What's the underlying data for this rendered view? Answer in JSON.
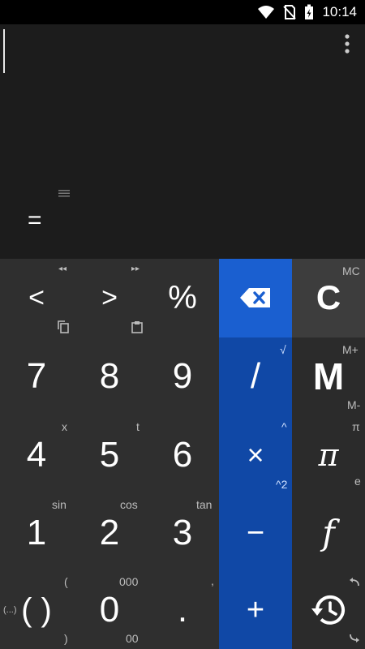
{
  "status": {
    "time": "10:14"
  },
  "display": {
    "equals": "="
  },
  "keys": {
    "row1": {
      "left": {
        "label": "<",
        "sub": "◂◂"
      },
      "right": {
        "label": ">",
        "sub": "▸▸"
      },
      "percent": {
        "label": "%"
      },
      "backspace": {
        "label": ""
      },
      "clear": {
        "label": "C",
        "sub": "MC"
      }
    },
    "row2": {
      "seven": {
        "label": "7"
      },
      "eight": {
        "label": "8"
      },
      "nine": {
        "label": "9"
      },
      "divide": {
        "label": "/",
        "sub": "√"
      },
      "memory": {
        "label": "M",
        "sub_top": "M+",
        "sub_bottom": "M-"
      }
    },
    "row3": {
      "four": {
        "label": "4",
        "sub": "x"
      },
      "five": {
        "label": "5",
        "sub": "t"
      },
      "six": {
        "label": "6"
      },
      "multiply": {
        "label": "×",
        "sub_top": "^",
        "sub_bottom": "^2"
      },
      "pi": {
        "label": "π",
        "sub_top": "π",
        "sub_bottom": "e"
      }
    },
    "row4": {
      "one": {
        "label": "1",
        "sub": "sin"
      },
      "two": {
        "label": "2",
        "sub": "cos"
      },
      "three": {
        "label": "3",
        "sub": "tan"
      },
      "minus": {
        "label": "−"
      },
      "function": {
        "label": "f"
      }
    },
    "row5": {
      "paren": {
        "label": "( )",
        "sub_left": "(...)",
        "sub_top": "(",
        "sub_bottom": ")"
      },
      "zero": {
        "label": "0",
        "sub_top": "000",
        "sub_bottom": "00"
      },
      "dot": {
        "label": ".",
        "sub": ","
      },
      "plus": {
        "label": "+"
      },
      "history": {
        "label": ""
      }
    }
  }
}
